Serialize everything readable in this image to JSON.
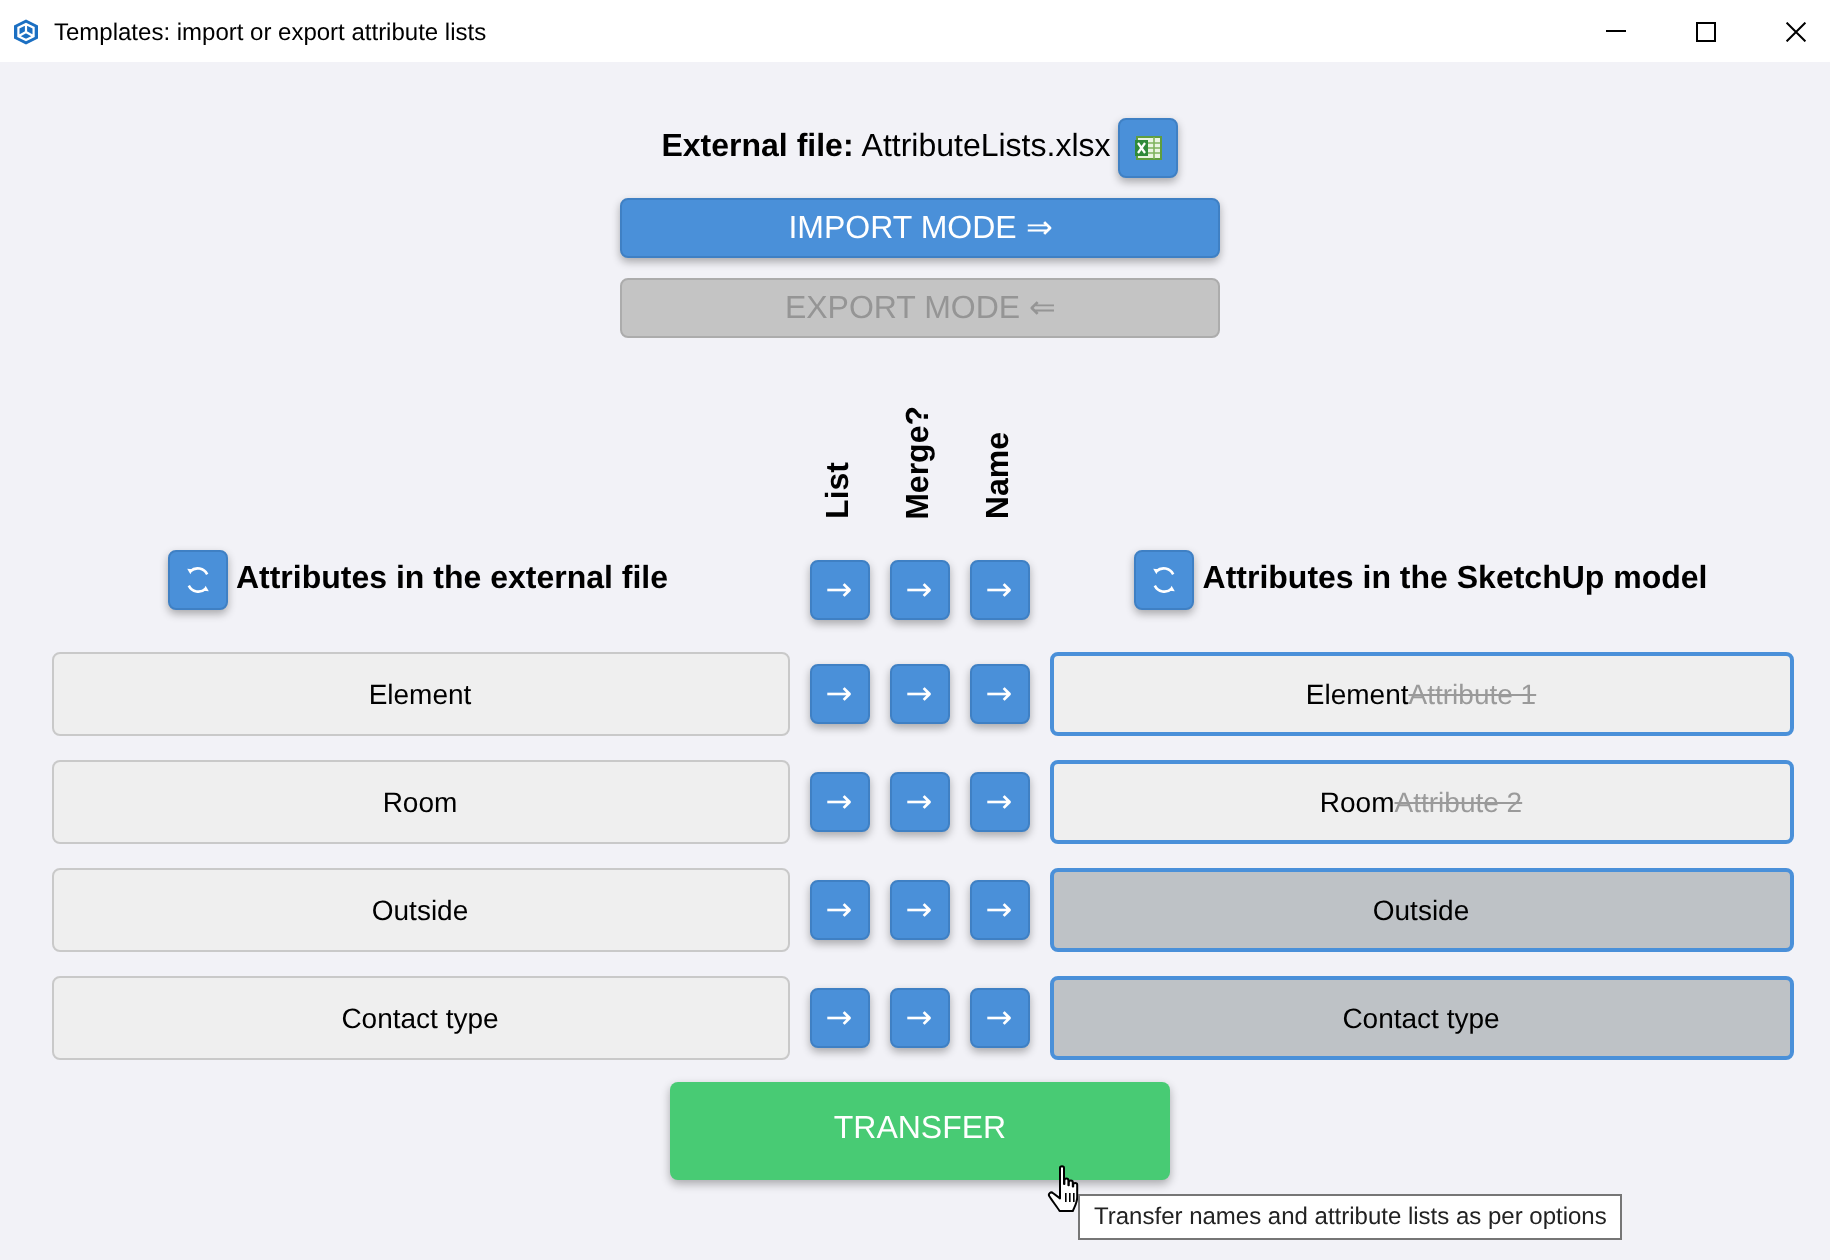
{
  "window": {
    "title": "Templates: import or export attribute lists"
  },
  "external_file": {
    "label": "External file:",
    "filename": "AttributeLists.xlsx"
  },
  "modes": [
    {
      "label": "IMPORT MODE ⇒",
      "selected": true
    },
    {
      "label": "EXPORT MODE ⇐",
      "selected": false
    }
  ],
  "option_columns": [
    {
      "label": "List",
      "arrow": "→"
    },
    {
      "label": "Merge?",
      "arrow": "→"
    },
    {
      "label": "Name",
      "arrow": "→"
    }
  ],
  "source": {
    "title": "Attributes in the external file"
  },
  "target": {
    "title": "Attributes in the SketchUp model"
  },
  "rows": [
    {
      "source": "Element",
      "arrows": [
        "→",
        "→",
        "→"
      ],
      "target": {
        "kind": "renamed",
        "name": "Element",
        "replaced": "Attribute 1"
      }
    },
    {
      "source": "Room",
      "arrows": [
        "→",
        "→",
        "→"
      ],
      "target": {
        "kind": "renamed",
        "name": "Room",
        "replaced": "Attribute 2"
      }
    },
    {
      "source": "Outside",
      "arrows": [
        "→",
        "→",
        "→"
      ],
      "target": {
        "kind": "existing",
        "name": "Outside"
      }
    },
    {
      "source": "Contact type",
      "arrows": [
        "→",
        "→",
        "→"
      ],
      "target": {
        "kind": "existing",
        "name": "Contact type"
      }
    }
  ],
  "transfer_button": {
    "label": "TRANSFER"
  },
  "tooltip": {
    "text": "Transfer names and attribute lists as per options"
  }
}
